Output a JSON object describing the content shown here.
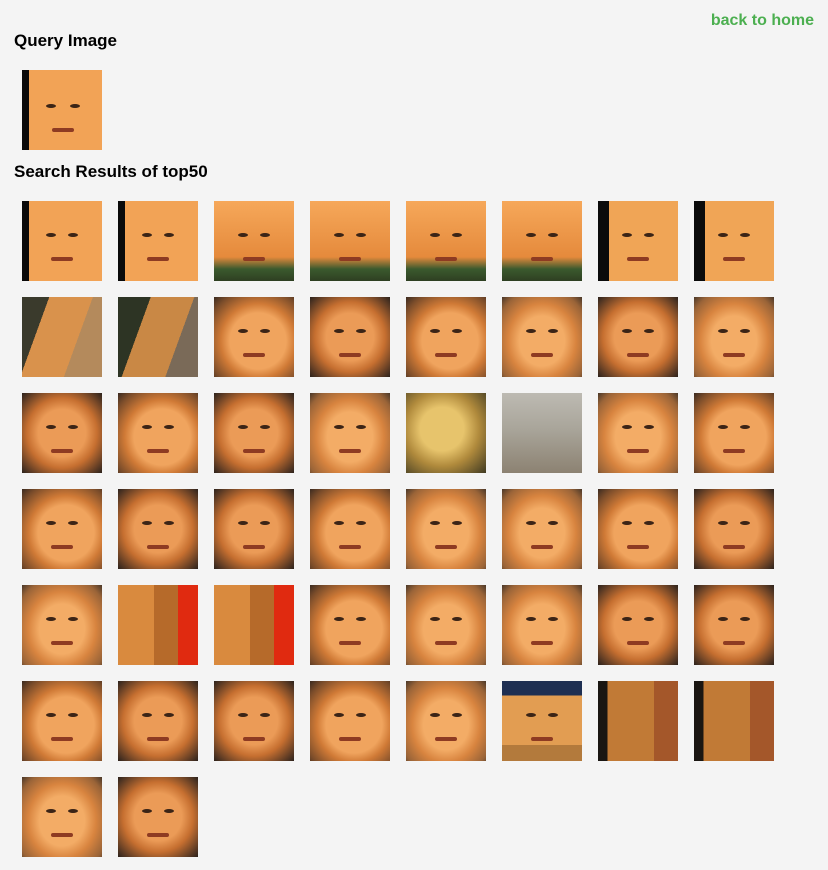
{
  "nav": {
    "back_label": "back to home"
  },
  "query": {
    "heading": "Query Image"
  },
  "results": {
    "heading": "Search Results of top50",
    "items": [
      {
        "tone": "tone-girl"
      },
      {
        "tone": "tone-girl"
      },
      {
        "tone": "tone-girl2"
      },
      {
        "tone": "tone-girl2"
      },
      {
        "tone": "tone-girl2"
      },
      {
        "tone": "tone-girl2"
      },
      {
        "tone": "tone-side"
      },
      {
        "tone": "tone-side"
      },
      {
        "tone": "tone-blur"
      },
      {
        "tone": "tone-blur2"
      },
      {
        "tone": "tone-man"
      },
      {
        "tone": "tone-man2"
      },
      {
        "tone": "tone-man"
      },
      {
        "tone": "tone-man3"
      },
      {
        "tone": "tone-man2"
      },
      {
        "tone": "tone-man3"
      },
      {
        "tone": "tone-man2"
      },
      {
        "tone": "tone-man"
      },
      {
        "tone": "tone-man2"
      },
      {
        "tone": "tone-man3"
      },
      {
        "tone": "tone-blurface"
      },
      {
        "tone": "tone-grey"
      },
      {
        "tone": "tone-man3"
      },
      {
        "tone": "tone-man"
      },
      {
        "tone": "tone-man"
      },
      {
        "tone": "tone-man2"
      },
      {
        "tone": "tone-man2"
      },
      {
        "tone": "tone-man"
      },
      {
        "tone": "tone-man3"
      },
      {
        "tone": "tone-man3"
      },
      {
        "tone": "tone-man"
      },
      {
        "tone": "tone-man2"
      },
      {
        "tone": "tone-man3"
      },
      {
        "tone": "tone-red"
      },
      {
        "tone": "tone-red"
      },
      {
        "tone": "tone-man"
      },
      {
        "tone": "tone-man3"
      },
      {
        "tone": "tone-man3"
      },
      {
        "tone": "tone-man2"
      },
      {
        "tone": "tone-man2"
      },
      {
        "tone": "tone-man"
      },
      {
        "tone": "tone-man2"
      },
      {
        "tone": "tone-man2"
      },
      {
        "tone": "tone-man"
      },
      {
        "tone": "tone-man3"
      },
      {
        "tone": "tone-cap"
      },
      {
        "tone": "tone-mblur"
      },
      {
        "tone": "tone-mblur"
      },
      {
        "tone": "tone-man3"
      },
      {
        "tone": "tone-man2"
      }
    ]
  },
  "colors": {
    "link": "#4caf50",
    "background": "#f4f4f4"
  }
}
